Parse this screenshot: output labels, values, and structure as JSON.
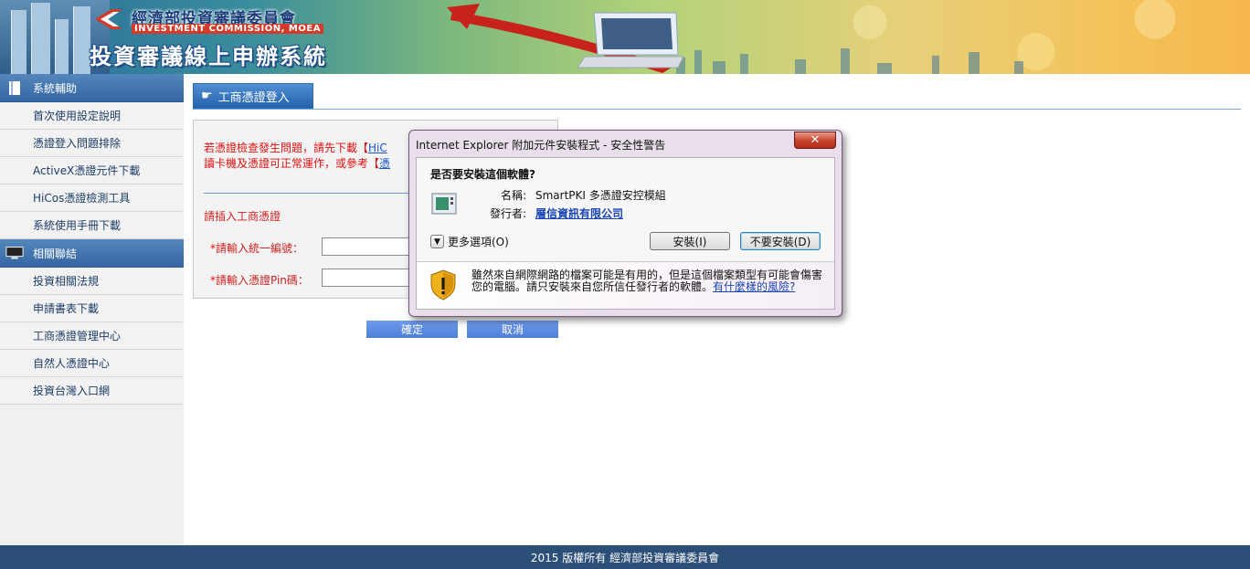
{
  "banner": {
    "org_name": "經濟部投資審議委員會",
    "org_name_en": "INVESTMENT COMMISSION, MOEA",
    "system_title": "投資審議線上申辦系統"
  },
  "sidebar": {
    "sections": [
      {
        "title": "系統輔助",
        "icon": "book-icon",
        "items": [
          "首次使用設定說明",
          "憑證登入問題排除",
          "ActiveX憑證元件下載",
          "HiCos憑證檢測工具",
          "系統使用手冊下載"
        ]
      },
      {
        "title": "相關聯結",
        "icon": "monitor-icon",
        "items": [
          "投資相關法規",
          "申請書表下載",
          "工商憑證管理中心",
          "自然人憑證中心",
          "投資台灣入口網"
        ]
      }
    ]
  },
  "main": {
    "tab_label": "工商憑證登入",
    "notice_line1": "若憑證檢查發生問題，請先下載【",
    "notice_link1": "HiC",
    "notice_line2": "讀卡機及憑證可正常運作，或參考【",
    "notice_link2": "憑",
    "insert_label": "請插入工商憑證",
    "fields": [
      {
        "label": "請輸入統一編號：",
        "value": ""
      },
      {
        "label": "請輸入憑證Pin碼：",
        "value": ""
      }
    ],
    "confirm_label": "確定",
    "cancel_label": "取消"
  },
  "dialog": {
    "title": "Internet Explorer 附加元件安裝程式 - 安全性警告",
    "close_label": "✕",
    "question": "是否要安裝這個軟體?",
    "name_label": "名稱:",
    "name_value": "SmartPKI 多憑證安控模組",
    "publisher_label": "發行者:",
    "publisher_value": "層信資訊有限公司",
    "more_options": "更多選項(O)",
    "install_label": "安裝(I)",
    "dont_install_label": "不要安裝(D)",
    "warning_text": "雖然來自網際網路的檔案可能是有用的，但是這個檔案類型有可能會傷害您的電腦。請只安裝來自您所信任發行者的軟體。",
    "risk_link": "有什麼樣的風險?"
  },
  "footer": {
    "copyright": "2015 版權所有 經濟部投資審議委員會"
  },
  "colors": {
    "sidebar_header": "#3d6fab",
    "footer": "#2b4f77",
    "accent_blue": "#2561ad",
    "notice_red": "#d11111"
  }
}
